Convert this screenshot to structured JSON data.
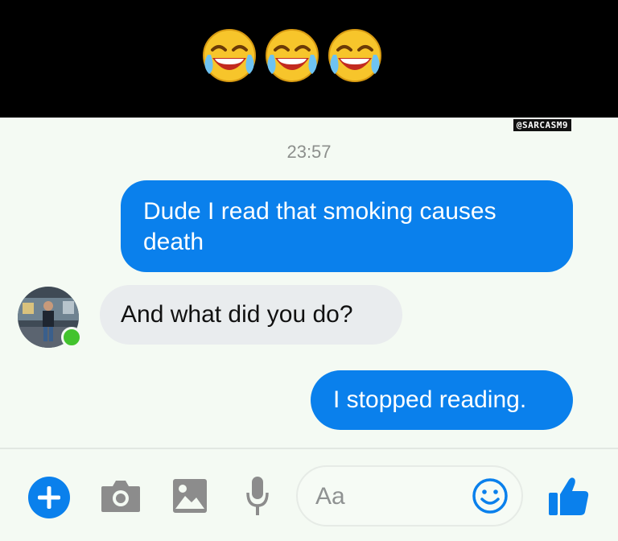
{
  "watermark": "@SARCASM9",
  "conversation": {
    "timestamp": "23:57",
    "messages": [
      {
        "sender": "me",
        "text": "Dude I read that smoking causes death"
      },
      {
        "sender": "friend",
        "text": "And what did you do?"
      },
      {
        "sender": "me",
        "text": "I stopped reading."
      }
    ]
  },
  "composer": {
    "placeholder": "Aa",
    "icons": [
      "plus-icon",
      "camera-icon",
      "image-icon",
      "microphone-icon",
      "smiley-icon",
      "thumbs-up-icon"
    ]
  },
  "colors": {
    "outgoing_bubble": "#0a80ec",
    "incoming_bubble": "#e9ecee",
    "accent": "#0a80ec",
    "presence": "#42c32d",
    "banner": "#000000"
  }
}
